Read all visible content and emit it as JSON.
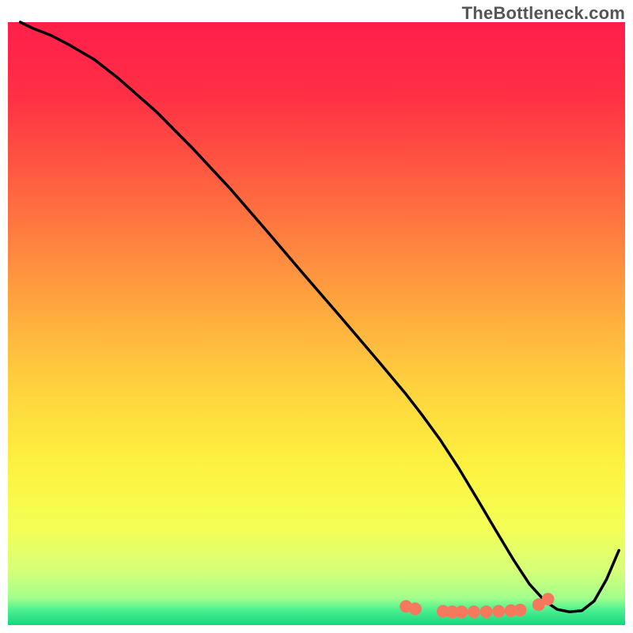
{
  "watermark": "TheBottleneck.com",
  "chart_data": {
    "type": "line",
    "title": "",
    "xlabel": "",
    "ylabel": "",
    "xlim": [
      0,
      100
    ],
    "ylim": [
      0,
      100
    ],
    "grid": false,
    "background_gradient": {
      "stops": [
        {
          "offset": 0.0,
          "color": "#ff1f4a"
        },
        {
          "offset": 0.12,
          "color": "#ff2f45"
        },
        {
          "offset": 0.25,
          "color": "#ff5a41"
        },
        {
          "offset": 0.38,
          "color": "#ff873f"
        },
        {
          "offset": 0.5,
          "color": "#ffb13e"
        },
        {
          "offset": 0.62,
          "color": "#ffd63e"
        },
        {
          "offset": 0.74,
          "color": "#fdf33f"
        },
        {
          "offset": 0.84,
          "color": "#f3ff56"
        },
        {
          "offset": 0.91,
          "color": "#d6ff78"
        },
        {
          "offset": 0.955,
          "color": "#a2ff8d"
        },
        {
          "offset": 0.975,
          "color": "#4bf08f"
        },
        {
          "offset": 1.0,
          "color": "#18d47e"
        }
      ]
    },
    "series": [
      {
        "name": "bottleneck-curve",
        "color": "#000000",
        "x": [
          2,
          4,
          7,
          10,
          14,
          18,
          24,
          30,
          36,
          42,
          48,
          54,
          60,
          64.5,
          67,
          70,
          73,
          76,
          79,
          82,
          84.5,
          87,
          89,
          91,
          93,
          95,
          97,
          99
        ],
        "y": [
          100,
          99,
          97.8,
          96.2,
          93.8,
          90.6,
          85.2,
          79.0,
          72.4,
          65.3,
          58.1,
          51.0,
          43.8,
          38.3,
          35.0,
          30.8,
          26.1,
          21.0,
          15.8,
          10.7,
          6.8,
          4.0,
          2.6,
          2.2,
          2.4,
          4.0,
          7.6,
          12.4
        ]
      }
    ],
    "markers": {
      "name": "highlight-dots",
      "color": "#f6795d",
      "radius_px": 8,
      "x": [
        64.5,
        66.0,
        70.5,
        72.0,
        73.5,
        75.5,
        77.5,
        79.5,
        81.5,
        83.0,
        86.0,
        87.5
      ],
      "y": [
        3.1,
        2.7,
        2.3,
        2.2,
        2.2,
        2.2,
        2.2,
        2.3,
        2.4,
        2.5,
        3.4,
        4.3
      ]
    },
    "note": "Axes are percentage-normalized (0–100). y=0 is the bottom green band. Curve depicts bottleneck severity falling to a minimum around x≈76 then rising; red markers sit along the trough."
  }
}
